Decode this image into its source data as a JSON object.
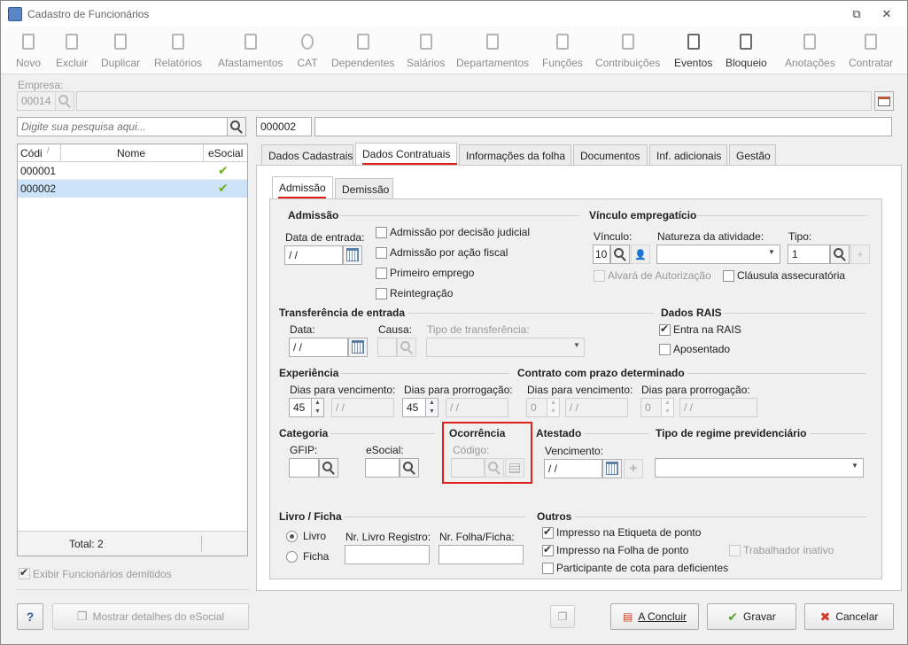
{
  "window": {
    "title": "Cadastro de Funcionários",
    "restore_glyph": "⧉",
    "close_glyph": "✕"
  },
  "toolbar": [
    {
      "label": "Novo",
      "enabled": false
    },
    {
      "label": "Excluir",
      "enabled": false
    },
    {
      "label": "Duplicar",
      "enabled": false
    },
    {
      "label": "Relatórios",
      "enabled": false
    },
    {
      "label": "Afastamentos",
      "enabled": false
    },
    {
      "label": "CAT",
      "enabled": false
    },
    {
      "label": "Dependentes",
      "enabled": false
    },
    {
      "label": "Salários",
      "enabled": false
    },
    {
      "label": "Departamentos",
      "enabled": false
    },
    {
      "label": "Funções",
      "enabled": false
    },
    {
      "label": "Contribuições",
      "enabled": false
    },
    {
      "label": "Eventos",
      "enabled": true
    },
    {
      "label": "Bloqueio",
      "enabled": true
    },
    {
      "label": "Anotações",
      "enabled": false
    },
    {
      "label": "Contratar",
      "enabled": false
    }
  ],
  "empresa": {
    "label": "Empresa:",
    "code": "00014",
    "name": ""
  },
  "search": {
    "placeholder": "Digite sua pesquisa aqui...",
    "code": "000002",
    "name": ""
  },
  "list": {
    "columns": [
      "Códi",
      "Nome",
      "eSocial"
    ],
    "rows": [
      {
        "code": "000001",
        "name": "",
        "esocial": "✔"
      },
      {
        "code": "000002",
        "name": "",
        "esocial": "✔"
      }
    ],
    "total": "Total: 2"
  },
  "show_dismissed": "Exibir Funcionários demitidos",
  "tabs": [
    "Dados Cadastrais",
    "Dados Contratuais",
    "Informações da folha",
    "Documentos",
    "Inf. adicionais",
    "Gestão"
  ],
  "subtabs": [
    "Admissão",
    "Demissão"
  ],
  "admissao": {
    "title": "Admissão",
    "data_entrada_label": "Data de entrada:",
    "data_entrada": " /  /",
    "checks": [
      "Admissão por decisão judicial",
      "Admissão por ação fiscal",
      "Primeiro emprego",
      "Reintegração"
    ]
  },
  "vinculo": {
    "title": "Vínculo empregatício",
    "vinculo_label": "Vínculo:",
    "vinculo": "10",
    "natureza_label": "Natureza da atividade:",
    "natureza": "",
    "tipo_label": "Tipo:",
    "tipo": "1",
    "alvara": "Alvará de Autorização",
    "clausula": "Cláusula assecuratória"
  },
  "transferencia": {
    "title": "Transferência de entrada",
    "data_label": "Data:",
    "data": " /  /",
    "causa_label": "Causa:",
    "tipo_label": "Tipo de transferência:"
  },
  "rais": {
    "title": "Dados RAIS",
    "entra": "Entra na RAIS",
    "aposentado": "Aposentado"
  },
  "experiencia": {
    "title": "Experiência",
    "dias_venc_label": "Dias para vencimento:",
    "dias_venc": "45",
    "venc_date": " /  /",
    "dias_prorr_label": "Dias para prorrogação:",
    "dias_prorr": "45",
    "prorr_date": " /  /"
  },
  "contrato": {
    "title": "Contrato com prazo determinado",
    "dias_venc_label": "Dias para vencimento:",
    "dias_venc": "0",
    "venc_date": " /  /",
    "dias_prorr_label": "Dias para prorrogação:",
    "dias_prorr": "0",
    "prorr_date": " /  /"
  },
  "categoria": {
    "title": "Categoria",
    "gfip_label": "GFIP:",
    "esocial_label": "eSocial:"
  },
  "ocorrencia": {
    "title": "Ocorrência",
    "codigo_label": "Código:",
    "highlight_color": "#e0201c"
  },
  "atestado": {
    "title": "Atestado",
    "venc_label": "Vencimento:",
    "venc": " /  /"
  },
  "regime": {
    "title": "Tipo de regime previdenciário"
  },
  "livro": {
    "title": "Livro / Ficha",
    "opt_livro": "Livro",
    "opt_ficha": "Ficha",
    "nr_livro_label": "Nr. Livro Registro:",
    "nr_folha_label": "Nr. Folha/Ficha:"
  },
  "outros": {
    "title": "Outros",
    "etiqueta": "Impresso na Etiqueta de ponto",
    "folha": "Impresso na Folha de ponto",
    "inativo": "Trabalhador inativo",
    "cota": "Participante de cota para deficientes"
  },
  "footer": {
    "help": "?",
    "esocial_details": "Mostrar detalhes do eSocial",
    "concluir": "A Concluir",
    "gravar": "Gravar",
    "cancelar": "Cancelar"
  }
}
